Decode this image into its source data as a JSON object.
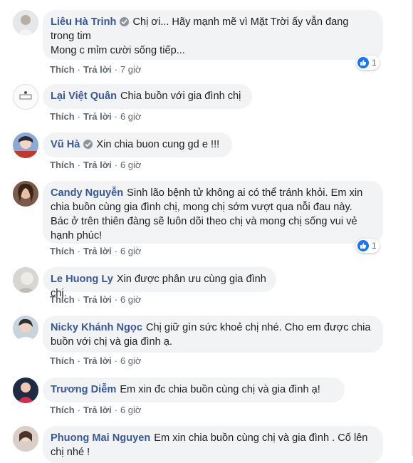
{
  "actions": {
    "like": "Thích",
    "reply": "Trả lời"
  },
  "comments": [
    {
      "author": "Liêu Hà Trinh",
      "verified": true,
      "lines": [
        "Chị ơi... Hãy mạnh mẽ vì Mặt Trời ấy vẫn đang",
        "trong tim",
        "Mong c mỉm cười sống tiếp..."
      ],
      "time": "7 giờ",
      "reactions": "1"
    },
    {
      "author": "Lại Việt Quân",
      "verified": false,
      "lines": [
        "Chia buồn với gia đình chị"
      ],
      "time": "6 giờ"
    },
    {
      "author": "Vũ Hà",
      "verified": true,
      "lines": [
        "Xin chia buon cung gd e !!!"
      ],
      "time": "6 giờ"
    },
    {
      "author": "Candy Nguyễn",
      "verified": false,
      "lines": [
        "Sinh lão bệnh tử không ai có thể tránh khỏi. Em xin",
        "chia buồn cùng gia đình chị, mong chị sớm vượt qua nỗi đau này.",
        "Bác ở trên thiên đàng sẽ luôn dõi theo chị và mong chị sống vui vẻ",
        "hạnh phúc!"
      ],
      "time": "6 giờ",
      "reactions": "1"
    },
    {
      "author": "Le Huong Ly",
      "verified": false,
      "lines": [
        "Xin được phân ưu cùng gia đình chị."
      ],
      "time": "6 giờ"
    },
    {
      "author": "Nicky Khánh Ngọc",
      "verified": false,
      "lines": [
        "Chị giữ gìn sức khoẻ chị nhé. Cho em được chia",
        "buồn với chị và gia đình ạ."
      ],
      "time": "6 giờ"
    },
    {
      "author": "Trương Diễm",
      "verified": false,
      "lines": [
        "Em xin đc chia buồn cùng chị và gia đình ạ!"
      ],
      "time": "6 giờ"
    },
    {
      "author": "Phuong Mai Nguyen",
      "verified": false,
      "lines": [
        "Em xin chia buồn cùng chị và gia đình . Cố lên",
        "chị nhé !"
      ],
      "time": ""
    }
  ],
  "colors": {
    "author": "#385898",
    "bubble": "#f2f3f5",
    "like": "#1877f2"
  },
  "icons": {
    "verified": "verified-badge-icon",
    "like": "like-thumb-icon"
  }
}
